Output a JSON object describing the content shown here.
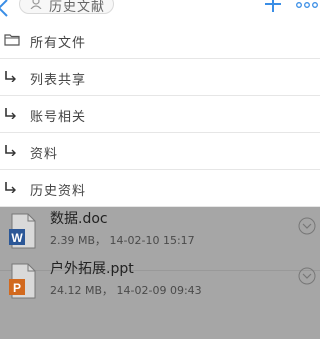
{
  "header": {
    "folder_name": "历史文献",
    "icons": {
      "back": "chevron-left-icon",
      "user": "user-icon",
      "add": "plus-icon",
      "more": "more-icon"
    },
    "accent_color": "#3a8ee6"
  },
  "dropdown": {
    "items": [
      {
        "label": "所有文件",
        "icon": "folder-icon"
      },
      {
        "label": "列表共享",
        "icon": "subfolder-arrow-icon"
      },
      {
        "label": "账号相关",
        "icon": "subfolder-arrow-icon"
      },
      {
        "label": "资料",
        "icon": "subfolder-arrow-icon"
      },
      {
        "label": "历史资料",
        "icon": "subfolder-arrow-icon"
      }
    ]
  },
  "files": [
    {
      "name": "数据.doc",
      "size": "2.39 MB",
      "date": "14-02-10 15:17",
      "meta": "2.39 MB，  14-02-10 15:17",
      "icon": "word-doc-icon",
      "icon_color": "#2b5797"
    },
    {
      "name": "户外拓展.ppt",
      "size": "24.12 MB",
      "date": "14-02-09 09:43",
      "meta": "24.12 MB，  14-02-09  09:43",
      "icon": "ppt-doc-icon",
      "icon_color": "#d2691e"
    }
  ]
}
